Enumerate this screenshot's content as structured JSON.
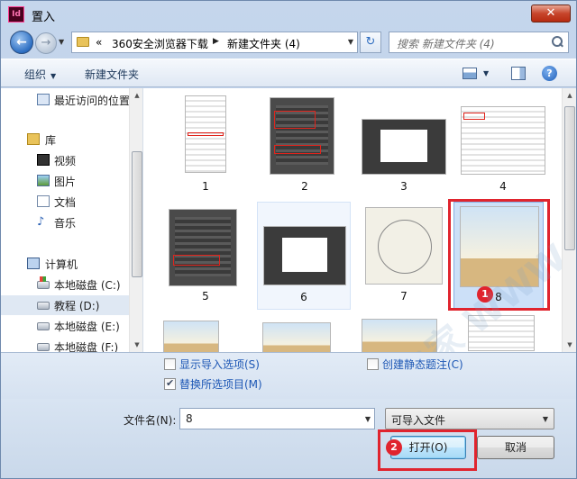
{
  "window": {
    "title": "置入",
    "app_icon": "Id",
    "close_label": "✕"
  },
  "nav": {
    "address_parts": [
      "«",
      "360安全浏览器下载",
      "新建文件夹 (4)"
    ],
    "search_placeholder": "搜索 新建文件夹 (4)"
  },
  "toolbar": {
    "organize": "组织",
    "new_folder": "新建文件夹"
  },
  "sidebar": {
    "items": [
      {
        "label": "最近访问的位置",
        "icon": "recent-places-icon"
      },
      {
        "label": "库",
        "icon": "library-icon"
      },
      {
        "label": "视频",
        "icon": "video-library-icon"
      },
      {
        "label": "图片",
        "icon": "pictures-library-icon"
      },
      {
        "label": "文档",
        "icon": "documents-library-icon"
      },
      {
        "label": "音乐",
        "icon": "music-library-icon"
      },
      {
        "label": "计算机",
        "icon": "computer-icon"
      },
      {
        "label": "本地磁盘 (C:)",
        "icon": "system-drive-icon"
      },
      {
        "label": "教程 (D:)",
        "icon": "drive-icon"
      },
      {
        "label": "本地磁盘 (E:)",
        "icon": "drive-icon"
      },
      {
        "label": "本地磁盘 (F:)",
        "icon": "drive-icon"
      }
    ]
  },
  "files": [
    {
      "name": "1"
    },
    {
      "name": "2"
    },
    {
      "name": "3"
    },
    {
      "name": "4"
    },
    {
      "name": "5"
    },
    {
      "name": "6"
    },
    {
      "name": "7"
    },
    {
      "name": "8"
    }
  ],
  "annotations": {
    "badge_1": "1",
    "badge_2": "2"
  },
  "options": {
    "show_import_options": "显示导入选项(S)",
    "create_static_caption": "创建静态题注(C)",
    "replace_selected": "替换所选项目(M)"
  },
  "footer": {
    "filename_label": "文件名(N):",
    "filename_value": "8",
    "filetype": "可导入文件",
    "open_button": "打开(O)",
    "cancel_button": "取消"
  },
  "watermark": "教程之家 WWW.RJZXW.COM",
  "colors": {
    "highlight_red": "#e0242e",
    "selection_blue": "#cce0f8",
    "link_blue": "#1d57b5"
  }
}
